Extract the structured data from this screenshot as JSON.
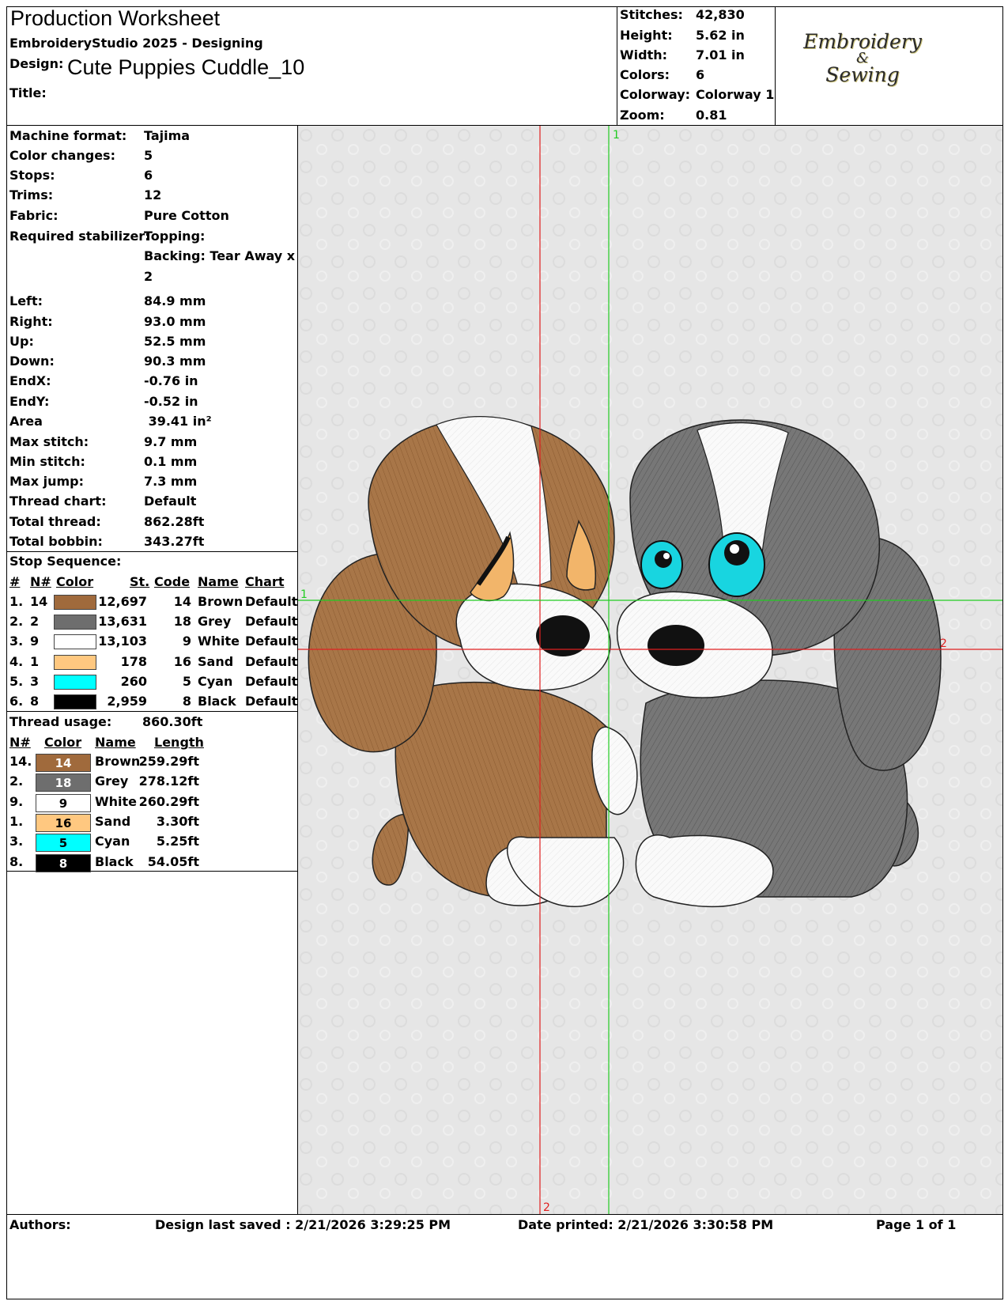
{
  "header": {
    "title": "Production Worksheet",
    "software": "EmbroideryStudio 2025 - Designing",
    "design_label": "Design:",
    "design_name": "Cute Puppies Cuddle_10",
    "title_label": "Title:"
  },
  "summary": [
    {
      "label": "Stitches:",
      "value": "42,830"
    },
    {
      "label": "Height:",
      "value": "5.62 in"
    },
    {
      "label": "Width:",
      "value": "7.01 in"
    },
    {
      "label": "Colors:",
      "value": "6"
    },
    {
      "label": "Colorway:",
      "value": "Colorway 1"
    },
    {
      "label": "Zoom:",
      "value": "0.81"
    }
  ],
  "logo": {
    "line1": "Embroidery",
    "line2": "&",
    "line3": "Sewing"
  },
  "details": [
    {
      "label": "Machine format:",
      "value": "Tajima"
    },
    {
      "label": "Color changes:",
      "value": "5"
    },
    {
      "label": "Stops:",
      "value": "6"
    },
    {
      "label": "Trims:",
      "value": "12"
    },
    {
      "label": "Fabric:",
      "value": "Pure Cotton"
    },
    {
      "label": "Required stabilizer:",
      "value": "Topping:"
    },
    {
      "label": "",
      "value": "Backing: Tear Away x"
    },
    {
      "label": "",
      "value": "2"
    },
    {
      "label": "Left:",
      "value": "84.9 mm"
    },
    {
      "label": "Right:",
      "value": "93.0 mm"
    },
    {
      "label": "Up:",
      "value": "52.5 mm"
    },
    {
      "label": "Down:",
      "value": "90.3 mm"
    },
    {
      "label": "EndX:",
      "value": "-0.76 in"
    },
    {
      "label": "EndY:",
      "value": "-0.52 in"
    },
    {
      "label": "Area",
      "value": " 39.41 in²"
    },
    {
      "label": "Max stitch:",
      "value": "9.7 mm"
    },
    {
      "label": "Min stitch:",
      "value": "0.1 mm"
    },
    {
      "label": "Max jump:",
      "value": "7.3 mm"
    },
    {
      "label": "Thread chart:",
      "value": "Default"
    },
    {
      "label": "Total thread:",
      "value": "862.28ft"
    },
    {
      "label": "Total bobbin:",
      "value": "343.27ft"
    }
  ],
  "stop_sequence": {
    "heading": "Stop Sequence:",
    "columns": [
      "#",
      "N#",
      "Color",
      "St.",
      "Code",
      "Name",
      "Chart"
    ],
    "rows": [
      {
        "idx": "1.",
        "n": "14",
        "color": "#a06a3c",
        "st": "12,697",
        "code": "14",
        "name": "Brown",
        "chart": "Default"
      },
      {
        "idx": "2.",
        "n": "2",
        "color": "#6e6e6e",
        "st": "13,631",
        "code": "18",
        "name": "Grey",
        "chart": "Default"
      },
      {
        "idx": "3.",
        "n": "9",
        "color": "#ffffff",
        "st": "13,103",
        "code": "9",
        "name": "White",
        "chart": "Default"
      },
      {
        "idx": "4.",
        "n": "1",
        "color": "#ffc880",
        "st": "178",
        "code": "16",
        "name": "Sand",
        "chart": "Default"
      },
      {
        "idx": "5.",
        "n": "3",
        "color": "#00ffff",
        "st": "260",
        "code": "5",
        "name": "Cyan",
        "chart": "Default"
      },
      {
        "idx": "6.",
        "n": "8",
        "color": "#000000",
        "st": "2,959",
        "code": "8",
        "name": "Black",
        "chart": "Default"
      }
    ]
  },
  "thread_usage": {
    "heading": "Thread usage:",
    "total": "860.30ft",
    "columns": [
      "N#",
      "Color",
      "Name",
      "Length"
    ],
    "rows": [
      {
        "n": "14.",
        "code": "14",
        "color": "#a06a3c",
        "text": "#ffffff",
        "name": "Brown",
        "length": "259.29ft"
      },
      {
        "n": "2.",
        "code": "18",
        "color": "#6e6e6e",
        "text": "#ffffff",
        "name": "Grey",
        "length": "278.12ft"
      },
      {
        "n": "9.",
        "code": "9",
        "color": "#ffffff",
        "text": "#000000",
        "name": "White",
        "length": "260.29ft"
      },
      {
        "n": "1.",
        "code": "16",
        "color": "#ffc880",
        "text": "#000000",
        "name": "Sand",
        "length": "3.30ft"
      },
      {
        "n": "3.",
        "code": "5",
        "color": "#00ffff",
        "text": "#000000",
        "name": "Cyan",
        "length": "5.25ft"
      },
      {
        "n": "8.",
        "code": "8",
        "color": "#000000",
        "text": "#ffffff",
        "name": "Black",
        "length": "54.05ft"
      }
    ]
  },
  "preview": {
    "axis_labels": {
      "green_top": "1",
      "green_left": "1",
      "red_bottom": "2",
      "red_right": "2"
    },
    "colors": {
      "background": "#e6e6e6",
      "red_axis": "#e02020",
      "green_axis": "#22cc22"
    }
  },
  "footer": {
    "authors": "Authors:",
    "saved": "Design last saved : 2/21/2026 3:29:25 PM",
    "printed": "Date printed: 2/21/2026 3:30:58 PM",
    "page": "Page 1 of 1"
  }
}
